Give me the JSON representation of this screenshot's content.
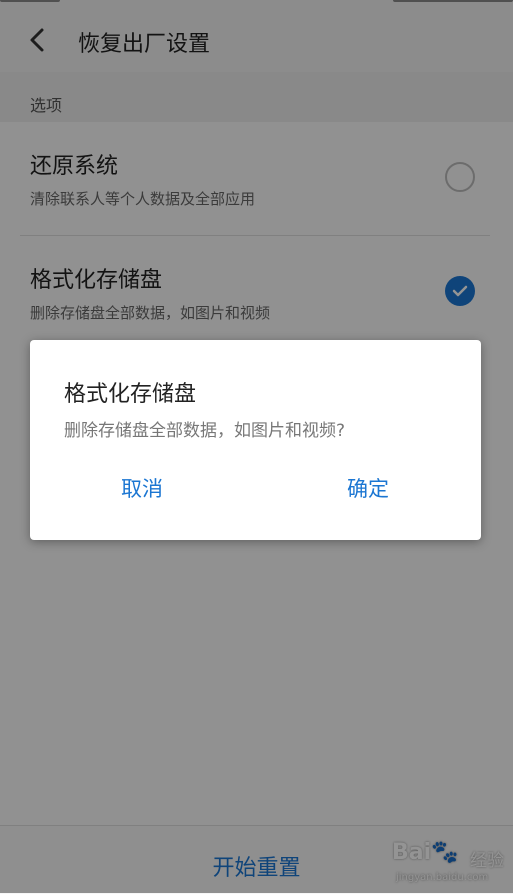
{
  "header": {
    "title": "恢复出厂设置"
  },
  "section": {
    "label": "选项"
  },
  "options": [
    {
      "title": "还原系统",
      "subtitle": "清除联系人等个人数据及全部应用",
      "checked": false
    },
    {
      "title": "格式化存储盘",
      "subtitle": "删除存储盘全部数据，如图片和视频",
      "checked": true
    }
  ],
  "bottom": {
    "start_label": "开始重置"
  },
  "dialog": {
    "title": "格式化存储盘",
    "message": "删除存储盘全部数据，如图片和视频?",
    "cancel_label": "取消",
    "ok_label": "确定"
  },
  "watermark": {
    "logo": "Bai🐾",
    "text": "经验",
    "url": "jingyan.baidu.com"
  },
  "colors": {
    "accent": "#1b76d2",
    "overlay": "rgba(0,0,0,0.42)"
  }
}
